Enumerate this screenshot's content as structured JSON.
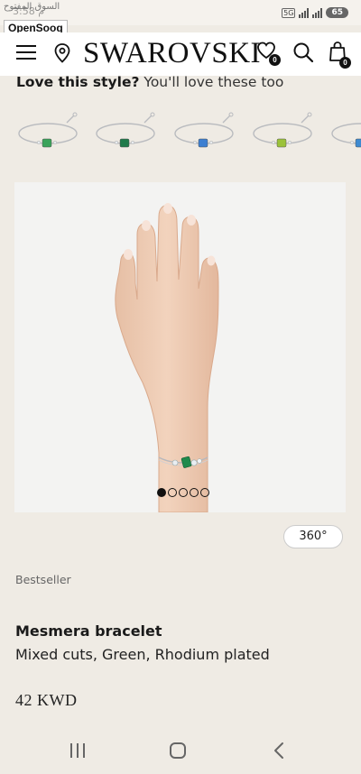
{
  "status_bar": {
    "time": "3:58 م",
    "network": "5G",
    "battery": "65",
    "watermark_arabic": "السوق المفتوح",
    "watermark_brand": "OpenSooq"
  },
  "header": {
    "logo": "SWAROVSKI",
    "wishlist_count": "0",
    "cart_count": "0"
  },
  "recommendations": {
    "title_bold": "Love this style?",
    "title_rest": " You'll love these too",
    "items": [
      {
        "stone_color": "#3aa35a"
      },
      {
        "stone_color": "#1f7a4a"
      },
      {
        "stone_color": "#3d7fd1"
      },
      {
        "stone_color": "#9bc23a"
      },
      {
        "stone_color": "#3d8ad1"
      }
    ]
  },
  "gallery": {
    "image_alt": "Hand wearing Mesmera bracelet",
    "dots": [
      true,
      false,
      false,
      false,
      false
    ]
  },
  "view_360_label": "360°",
  "product": {
    "badge": "Bestseller",
    "name": "Mesmera bracelet",
    "description": "Mixed cuts, Green, Rhodium plated",
    "price": "42 KWD"
  },
  "colors": {
    "background": "#efebe4",
    "stone_green": "#1f8a4c"
  }
}
